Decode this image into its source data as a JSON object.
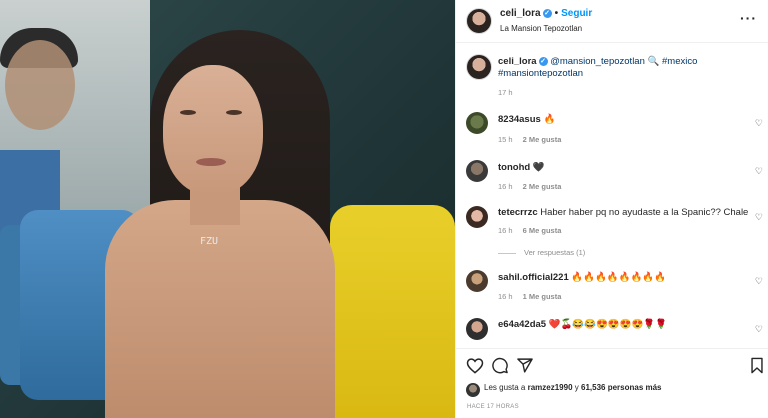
{
  "header": {
    "username": "celi_lora",
    "follow_label": "Seguir",
    "location": "La Mansion Tepozotlan",
    "more_label": "···"
  },
  "caption": {
    "username": "celi_lora",
    "text_mention": "@mansion_tepozotlan",
    "text_tag1": "#mexico",
    "text_tag2": "#mansiontepozotlan",
    "time": "17 h"
  },
  "comments": [
    {
      "user": "8234asus",
      "text": "🔥",
      "time": "15 h",
      "likes": "2 Me gusta",
      "replies": ""
    },
    {
      "user": "tonohd",
      "text": "🖤",
      "time": "16 h",
      "likes": "2 Me gusta",
      "replies": ""
    },
    {
      "user": "tetecrrzc",
      "text": "Haber haber pq no ayudaste a la Spanic?? Chale",
      "time": "16 h",
      "likes": "6 Me gusta",
      "replies": "Ver respuestas (1)"
    },
    {
      "user": "sahil.official221",
      "text": "🔥🔥🔥🔥🔥🔥🔥🔥",
      "time": "16 h",
      "likes": "1 Me gusta",
      "replies": ""
    },
    {
      "user": "e64a42da5",
      "text": "❤️🍒😂😂😍😍😍😍🌹🌹",
      "time": "",
      "likes": "",
      "replies": ""
    }
  ],
  "footer": {
    "likes_prefix": "Les gusta a",
    "likes_user": "ramzez1990",
    "likes_mid": "y",
    "likes_count": "61,536 personas más",
    "time_ago": "HACE 17 HORAS"
  },
  "photo": {
    "necklace_text": "FZU"
  },
  "colors": {
    "follow": "#0095f6",
    "link": "#00376b",
    "meta": "#8e8e8e",
    "verified": "#3897f0"
  },
  "icons": [
    "more-options-icon",
    "verified-icon",
    "heart-icon",
    "comment-icon",
    "share-icon",
    "bookmark-icon"
  ]
}
